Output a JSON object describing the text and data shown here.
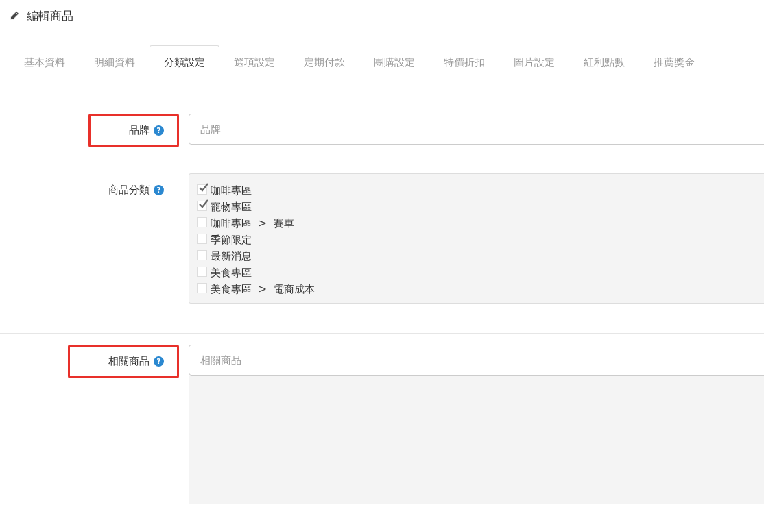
{
  "header": {
    "title": "編輯商品"
  },
  "tabs": [
    {
      "label": "基本資料",
      "selected": false
    },
    {
      "label": "明細資料",
      "selected": false
    },
    {
      "label": "分類設定",
      "selected": true
    },
    {
      "label": "選項設定",
      "selected": false
    },
    {
      "label": "定期付款",
      "selected": false
    },
    {
      "label": "團購設定",
      "selected": false
    },
    {
      "label": "特價折扣",
      "selected": false
    },
    {
      "label": "圖片設定",
      "selected": false
    },
    {
      "label": "紅利點數",
      "selected": false
    },
    {
      "label": "推薦獎金",
      "selected": false
    }
  ],
  "brand": {
    "label": "品牌",
    "help": "?",
    "highlighted": true,
    "placeholder": "品牌"
  },
  "categories": {
    "label": "商品分類",
    "help": "?",
    "highlighted": false,
    "items": [
      {
        "path": [
          "咖啡專區"
        ],
        "checked": true
      },
      {
        "path": [
          "寵物專區"
        ],
        "checked": true
      },
      {
        "path": [
          "咖啡專區",
          "賽車"
        ],
        "separator": ">",
        "checked": false
      },
      {
        "path": [
          "季節限定"
        ],
        "checked": false
      },
      {
        "path": [
          "最新消息"
        ],
        "checked": false
      },
      {
        "path": [
          "美食專區"
        ],
        "checked": false
      },
      {
        "path": [
          "美食專區",
          "電商成本"
        ],
        "separator": ">",
        "checked": false
      }
    ]
  },
  "related": {
    "label": "相關商品",
    "help": "?",
    "highlighted": true,
    "placeholder": "相關商品"
  }
}
